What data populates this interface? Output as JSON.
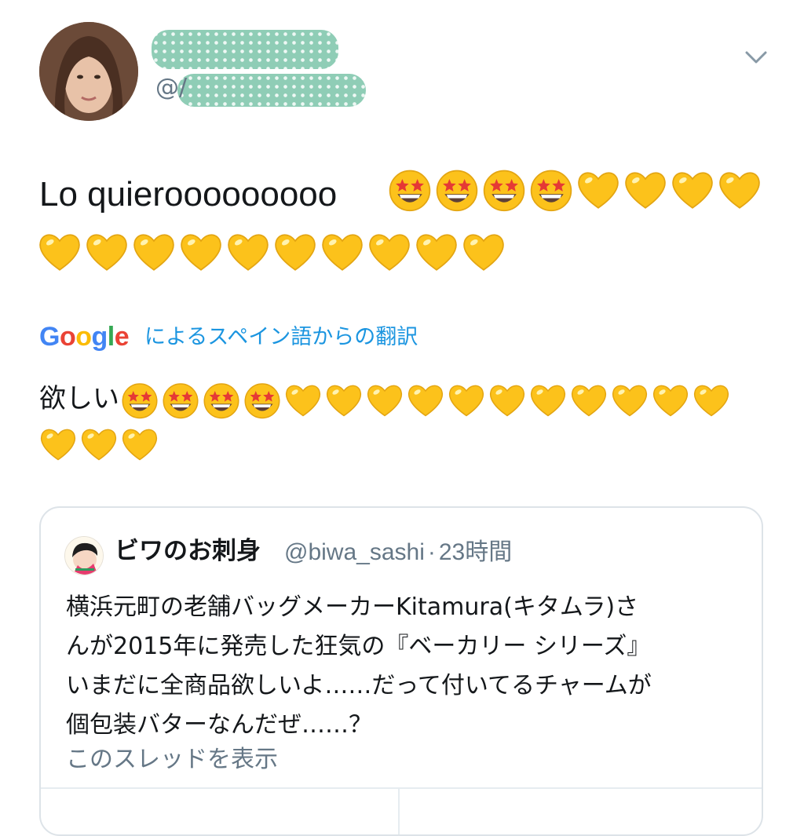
{
  "user": {
    "handle_prefix": "@/"
  },
  "tweet": {
    "line1_text": "Lo quierooooooooo",
    "line1_emoji": [
      "star-struck",
      "star-struck",
      "star-struck",
      "star-struck",
      "yellow-heart",
      "yellow-heart",
      "yellow-heart",
      "yellow-heart"
    ],
    "line2_emoji": [
      "yellow-heart",
      "yellow-heart",
      "yellow-heart",
      "yellow-heart",
      "yellow-heart",
      "yellow-heart",
      "yellow-heart",
      "yellow-heart",
      "yellow-heart",
      "yellow-heart"
    ]
  },
  "translation": {
    "provider": "Google",
    "label": "によるスペイン語からの翻訳",
    "text": "欲しい",
    "line1_emoji": [
      "star-struck",
      "star-struck",
      "star-struck",
      "star-struck",
      "yellow-heart",
      "yellow-heart",
      "yellow-heart",
      "yellow-heart",
      "yellow-heart",
      "yellow-heart",
      "yellow-heart",
      "yellow-heart",
      "yellow-heart",
      "yellow-heart",
      "yellow-heart"
    ],
    "line2_emoji": [
      "yellow-heart",
      "yellow-heart",
      "yellow-heart"
    ]
  },
  "quote": {
    "name": "ビワのお刺身",
    "handle": "@biwa_sashi",
    "separator": "·",
    "time": "23時間",
    "body_lines": [
      "横浜元町の老舗バッグメーカーKitamura(キタムラ)さ",
      "んが2015年に発売した狂気の『ベーカリー シリーズ』",
      "いまだに全商品欲しいよ……だって付いてるチャームが",
      "個包装バターなんだぜ……？"
    ],
    "show_thread": "このスレッドを表示"
  },
  "colors": {
    "link_blue": "#1b95e0",
    "secondary_gray": "#657786",
    "text_dark": "#14171a",
    "heart_yellow": "#fcc21b",
    "redaction_mint": "#8fcdb6",
    "google_blue": "#4285F4",
    "google_red": "#EA4335",
    "google_yellow": "#FBBC05",
    "google_green": "#34A853"
  }
}
